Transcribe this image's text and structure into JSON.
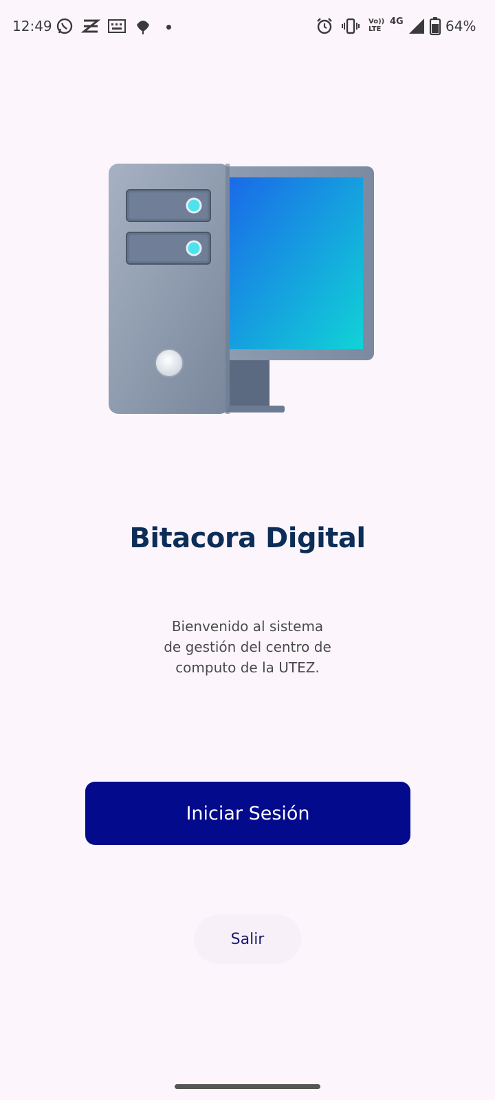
{
  "status_bar": {
    "time": "12:49",
    "battery_percent": "64%",
    "network_type": "4G",
    "volte_label": "Vo)) LTE",
    "left_icons": [
      "whatsapp-icon",
      "capcut-icon",
      "keyboard-icon",
      "bug-icon",
      "dot-icon"
    ],
    "right_icons": [
      "alarm-icon",
      "vibrate-icon",
      "volte-icon",
      "signal-icon",
      "battery-icon"
    ]
  },
  "hero": {
    "icon": "desktop-computer-illustration"
  },
  "app": {
    "title": "Bitacora Digital",
    "welcome_text": "Bienvenido al sistema\nde gestión del centro de\ncomputo de la UTEZ."
  },
  "actions": {
    "login_label": "Iniciar Sesión",
    "exit_label": "Salir"
  },
  "colors": {
    "background": "#fcf6fc",
    "primary": "#030a8c",
    "title": "#0c2d57",
    "exit_text": "#1c1a70"
  }
}
